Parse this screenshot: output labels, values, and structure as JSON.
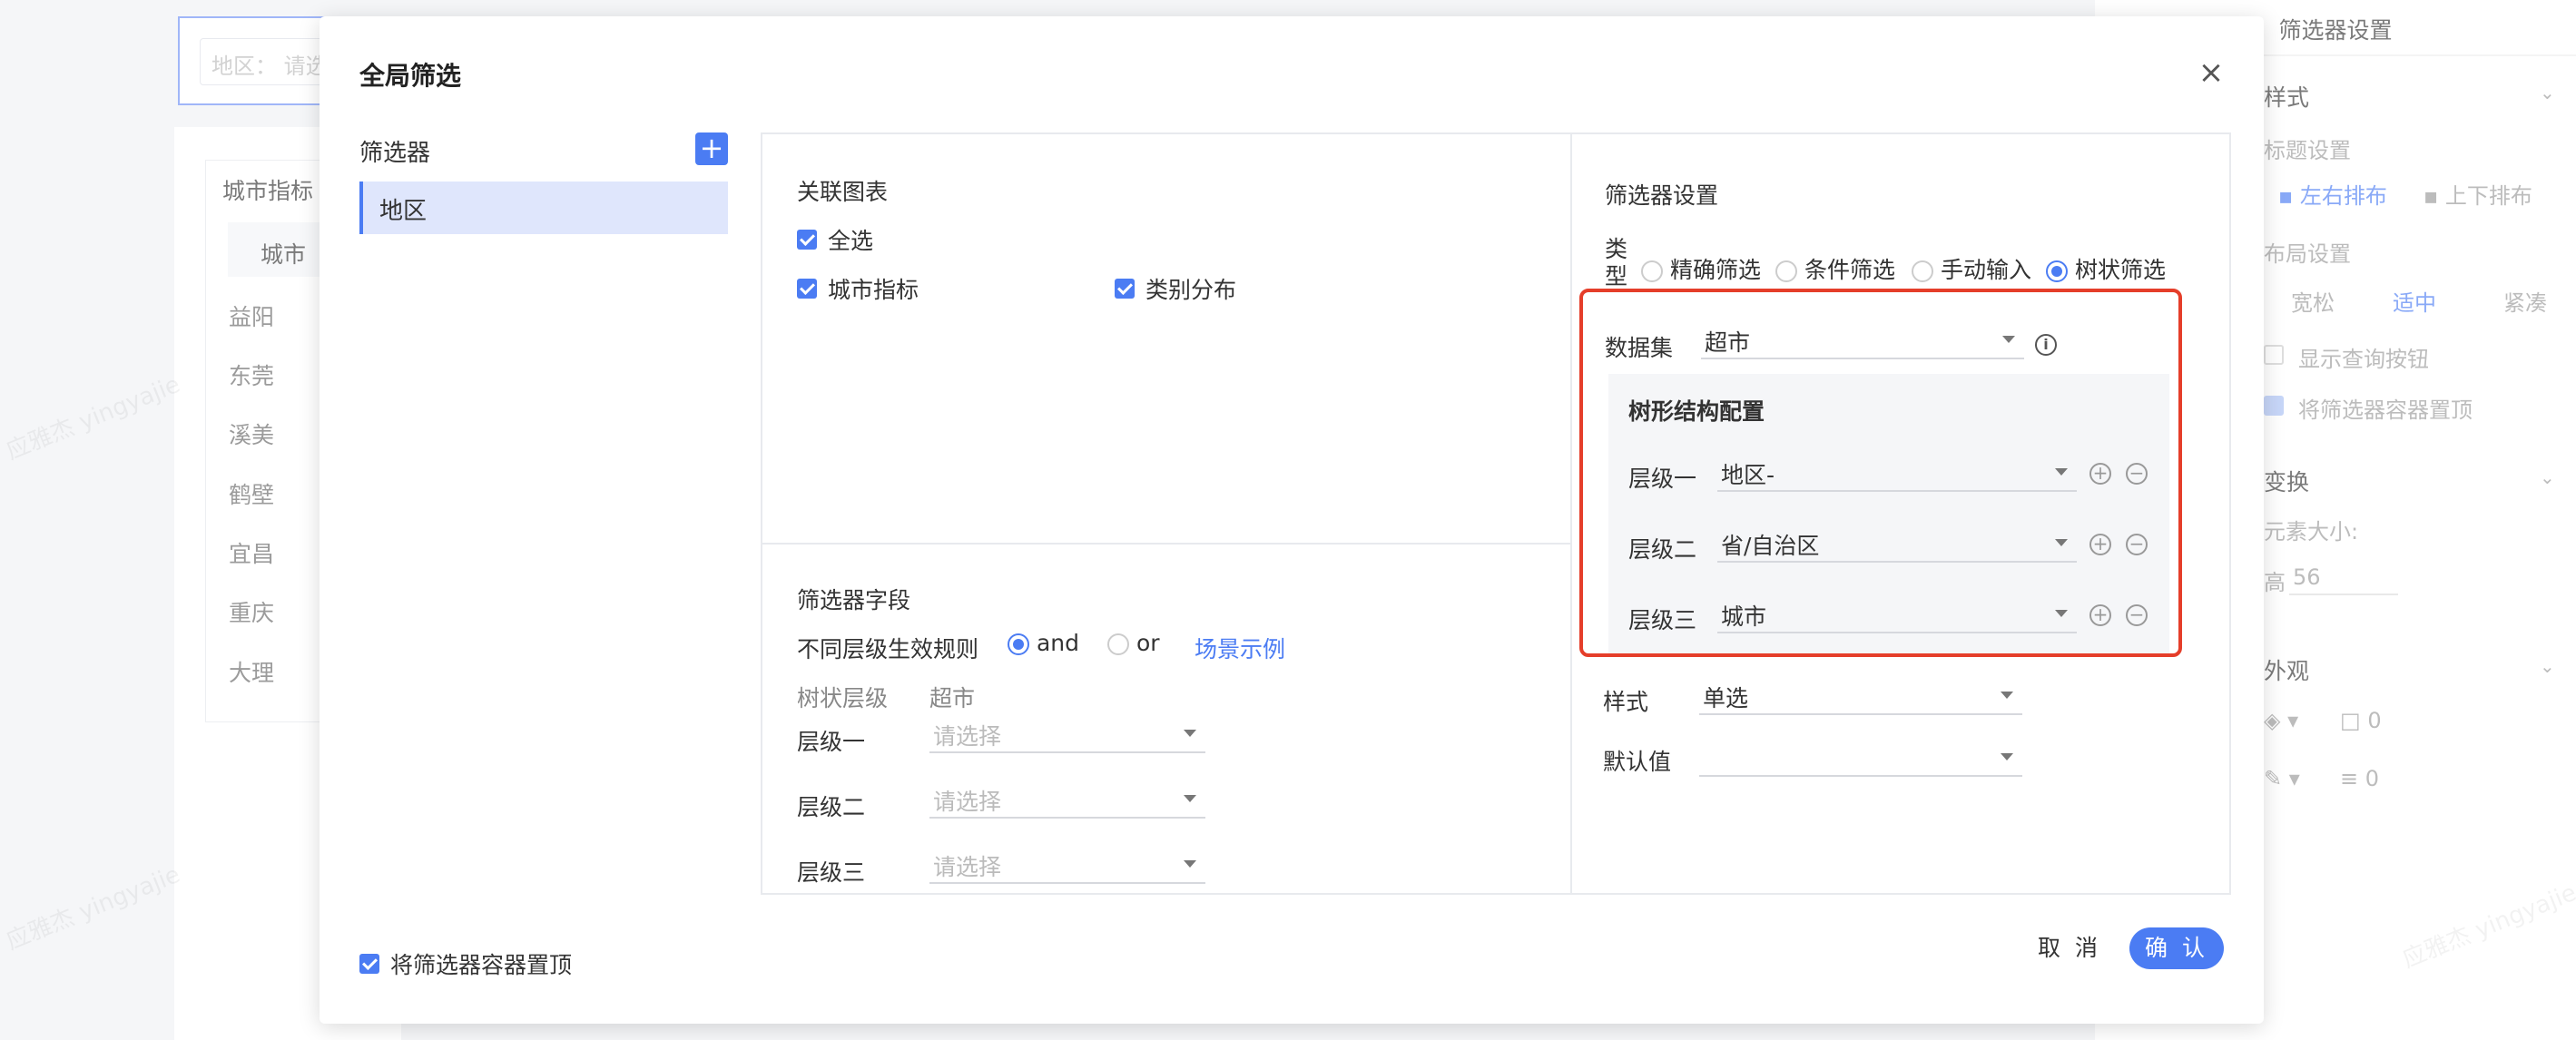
{
  "background": {
    "region_input_placeholder": "地区： 请选",
    "card_title": "城市指标",
    "table_header": "城市",
    "table_rows": [
      "益阳",
      "东莞",
      "溪美",
      "鹤壁",
      "宜昌",
      "重庆",
      "大理"
    ],
    "right_panel": {
      "title": "筛选器设置",
      "style_section": "样式",
      "title_setting": "标题设置",
      "layout_lr": "左右排布",
      "layout_tb": "上下排布",
      "layout_setting": "布局设置",
      "layout_options": [
        "宽松",
        "适中",
        "紧凑"
      ],
      "show_query_button": "显示查询按钮",
      "pin_container": "将筛选器容器置顶",
      "transform_section": "变换",
      "element_size": "元素大小:",
      "height_label": "高",
      "height_value": "56",
      "appearance_section": "外观",
      "fill_value": "0",
      "border_value": "0"
    }
  },
  "modal": {
    "title": "全局筛选",
    "close_glyph": "×",
    "filter_list_label": "筛选器",
    "add_glyph": "+",
    "filter_items": [
      "地区"
    ],
    "linked_charts": {
      "title": "关联图表",
      "select_all": "全选",
      "charts": [
        "城市指标",
        "类别分布"
      ]
    },
    "filter_fields": {
      "title": "筛选器字段",
      "rule_label": "不同层级生效规则",
      "rule_and": "and",
      "rule_or": "or",
      "scene_example": "场景示例",
      "col_tree_level": "树状层级",
      "col_dataset": "超市",
      "levels": [
        {
          "label": "层级一",
          "placeholder": "请选择"
        },
        {
          "label": "层级二",
          "placeholder": "请选择"
        },
        {
          "label": "层级三",
          "placeholder": "请选择"
        }
      ]
    },
    "settings": {
      "title": "筛选器设置",
      "type_label": "类型",
      "type_options": [
        "精确筛选",
        "条件筛选",
        "手动输入",
        "树状筛选"
      ],
      "selected_type": "树状筛选",
      "dataset_label": "数据集",
      "dataset_value": "超市",
      "info_glyph": "i",
      "tree_title": "树形结构配置",
      "tree_levels": [
        {
          "label": "层级一",
          "value": "地区-"
        },
        {
          "label": "层级二",
          "value": "省/自治区"
        },
        {
          "label": "层级三",
          "value": "城市"
        }
      ],
      "style_label": "样式",
      "style_value": "单选",
      "default_label": "默认值",
      "default_value": ""
    },
    "footer": {
      "pin_label": "将筛选器容器置顶",
      "cancel": "取 消",
      "confirm": "确 认"
    }
  },
  "colors": {
    "accent": "#4b7cf3",
    "highlight": "#e53e2a"
  },
  "watermark": "应雅杰 yingyajie"
}
